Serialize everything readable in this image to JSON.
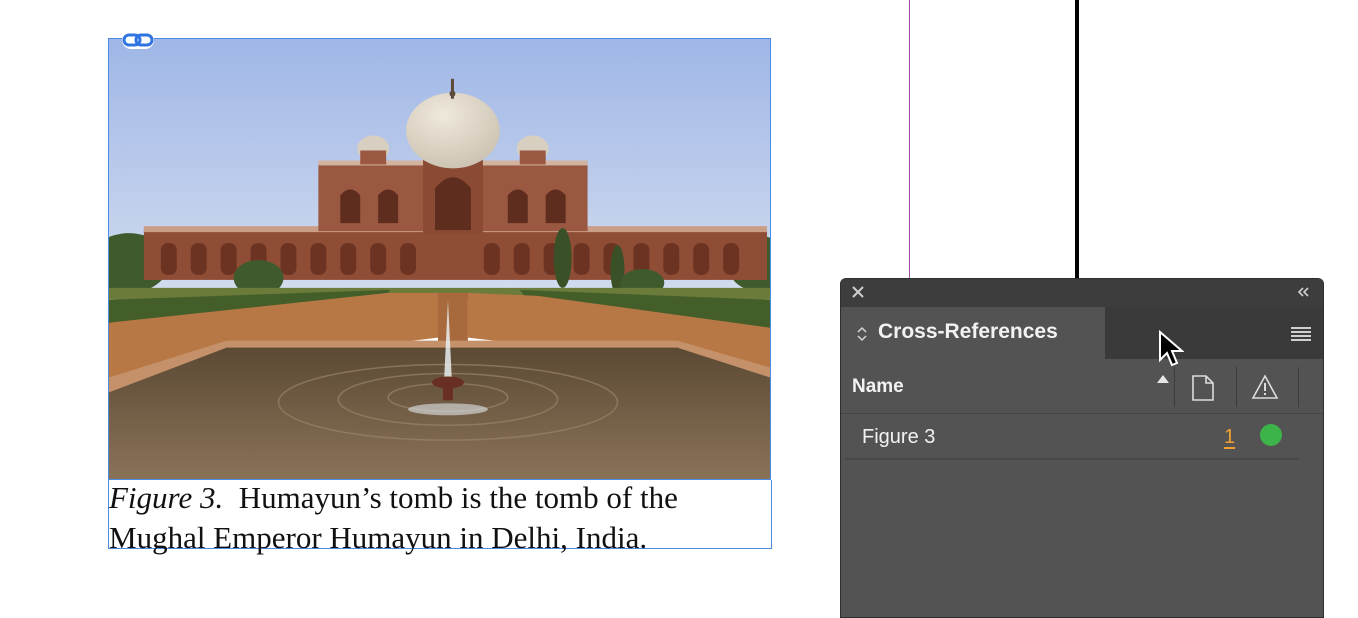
{
  "document": {
    "image_alt": "Humayun's tomb photograph",
    "caption_label": "Figure 3.",
    "caption_text": "Humayun’s tomb is the tomb of the Mughal Emperor Humayun in Delhi, India."
  },
  "panel": {
    "title": "Cross-References",
    "columns": {
      "name": "Name"
    },
    "rows": [
      {
        "name": "Figure 3",
        "page": "1",
        "status": "ok"
      }
    ],
    "colors": {
      "status_ok": "#3db44a",
      "page_link": "#f0a030"
    }
  },
  "icons": {
    "link": "link-icon",
    "close": "close-icon",
    "collapse": "double-chevron-left-icon",
    "tab_arrows": "up-down-arrows-icon",
    "menu": "hamburger-menu-icon",
    "sort": "sort-ascending-icon",
    "page": "page-icon",
    "warning": "warning-icon",
    "cursor": "mouse-pointer-icon"
  }
}
